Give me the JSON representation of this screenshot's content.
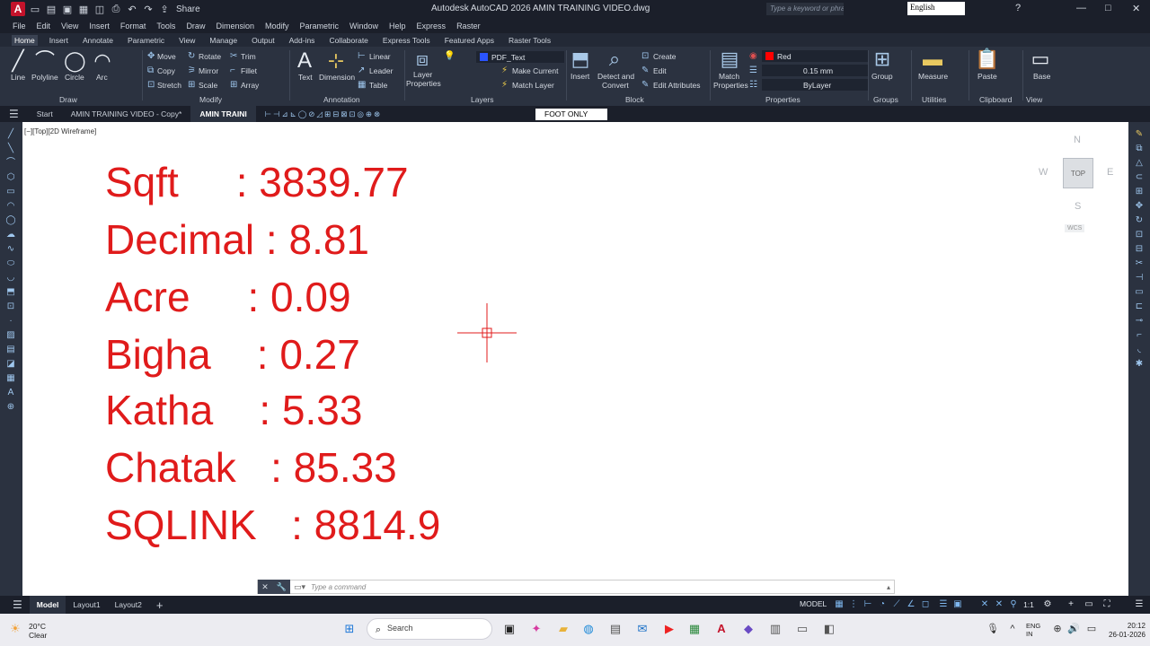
{
  "titlebar": {
    "app_icon": "A",
    "share": "Share",
    "title": "Autodesk AutoCAD 2026   AMIN TRAINING VIDEO.dwg",
    "search_placeholder": "Type a keyword or phrase",
    "language": "English",
    "window_controls": [
      "—",
      "□",
      "✕"
    ]
  },
  "menubar": [
    "File",
    "Edit",
    "View",
    "Insert",
    "Format",
    "Tools",
    "Draw",
    "Dimension",
    "Modify",
    "Parametric",
    "Window",
    "Help",
    "Express",
    "Raster"
  ],
  "ribbon_tabs": [
    {
      "label": "Home",
      "active": true
    },
    {
      "label": "Insert"
    },
    {
      "label": "Annotate"
    },
    {
      "label": "Parametric"
    },
    {
      "label": "View"
    },
    {
      "label": "Manage"
    },
    {
      "label": "Output"
    },
    {
      "label": "Add-ins"
    },
    {
      "label": "Collaborate"
    },
    {
      "label": "Express Tools"
    },
    {
      "label": "Featured Apps"
    },
    {
      "label": "Raster Tools"
    }
  ],
  "ribbon": {
    "draw": {
      "label": "Draw",
      "line": "Line",
      "polyline": "Polyline",
      "circle": "Circle",
      "arc": "Arc"
    },
    "modify": {
      "label": "Modify",
      "move": "Move",
      "rotate": "Rotate",
      "trim": "Trim",
      "copy": "Copy",
      "mirror": "Mirror",
      "fillet": "Fillet",
      "stretch": "Stretch",
      "scale": "Scale",
      "array": "Array"
    },
    "annotation": {
      "label": "Annotation",
      "text": "Text",
      "dimension": "Dimension",
      "linear": "Linear",
      "leader": "Leader",
      "table": "Table"
    },
    "layers": {
      "label": "Layers",
      "layer_properties": "Layer",
      "layer_properties2": "Properties",
      "current_layer": "PDF_Text",
      "make_current": "Make Current",
      "match_layer": "Match Layer"
    },
    "block": {
      "label": "Block",
      "insert": "Insert",
      "detect": "Detect and",
      "convert": "Convert",
      "create": "Create",
      "edit": "Edit",
      "edit_attributes": "Edit Attributes"
    },
    "properties": {
      "label": "Properties",
      "match": "Match",
      "match2": "Properties",
      "color": "Red",
      "lineweight": "0.15 mm",
      "linetype": "ByLayer"
    },
    "groups": {
      "label": "Groups",
      "group": "Group"
    },
    "utilities": {
      "label": "Utilities",
      "measure": "Measure"
    },
    "clipboard": {
      "label": "Clipboard",
      "paste": "Paste"
    },
    "view": {
      "label": "View",
      "base": "Base"
    }
  },
  "file_tabs": {
    "start": "Start",
    "tab1": "AMIN TRAINING VIDEO - Copy*",
    "tab2": "AMIN TRAINI",
    "layer_state": "FOOT ONLY"
  },
  "viewport": {
    "label": "[−][Top][2D Wireframe]",
    "viewcube_face": "TOP",
    "north": "N",
    "south": "S",
    "east": "E",
    "west": "W",
    "wcs": "WCS"
  },
  "drawing_text": [
    "Sqft     : 3839.77",
    "Decimal : 8.81",
    "Acre     : 0.09",
    "Bigha    : 0.27",
    "Katha    : 5.33",
    "Chatak   : 85.33",
    "SQLINK   : 8814.9"
  ],
  "command_line": {
    "placeholder": "Type a command"
  },
  "layout_tabs": [
    {
      "label": "Model",
      "active": true
    },
    {
      "label": "Layout1"
    },
    {
      "label": "Layout2"
    }
  ],
  "status": {
    "model": "MODEL",
    "scale": "1:1"
  },
  "taskbar": {
    "temperature": "20°C",
    "weather": "Clear",
    "search": "Search",
    "lang1": "ENG",
    "lang2": "IN",
    "time": "20:12",
    "date": "26-01-2026"
  },
  "colors": {
    "drawing_text": "#e01b1b",
    "canvas": "#ffffff",
    "app_bg": "#1f2430",
    "ribbon": "#2b3240"
  }
}
